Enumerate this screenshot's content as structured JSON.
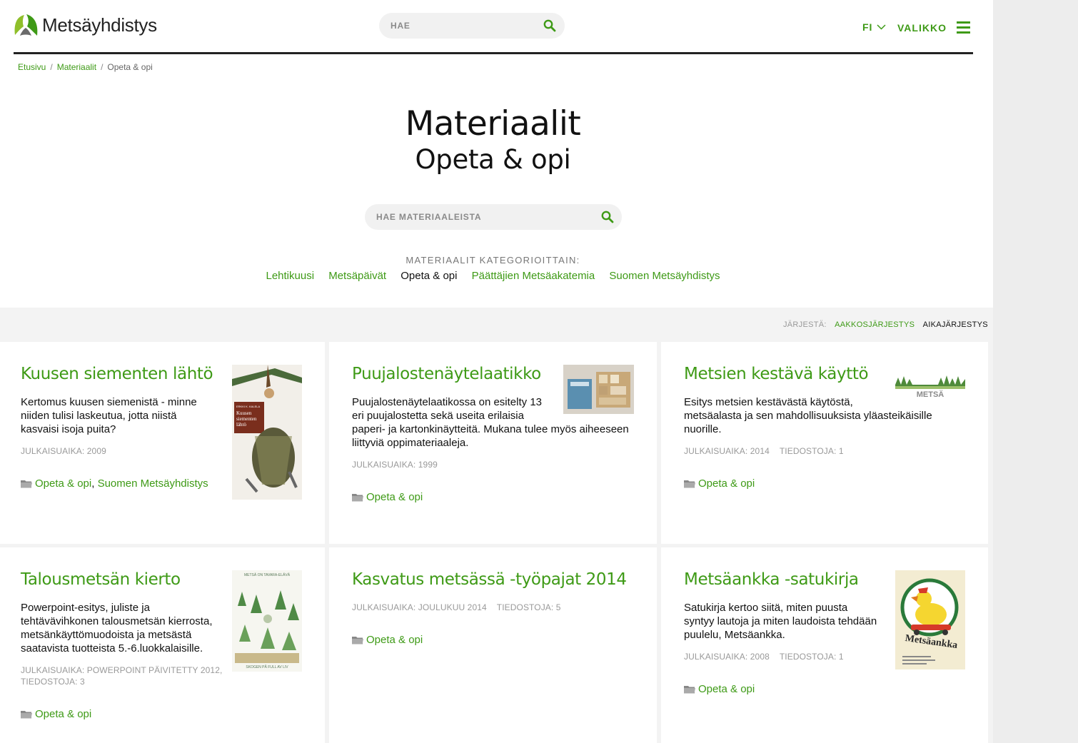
{
  "header": {
    "logo_text": "Metsäyhdistys",
    "search_placeholder": "HAE",
    "lang": "FI",
    "menu_label": "VALIKKO"
  },
  "breadcrumb": [
    "Etusivu",
    "Materiaalit",
    "Opeta & opi"
  ],
  "page": {
    "title": "Materiaalit",
    "subtitle": "Opeta & opi",
    "search_placeholder": "HAE MATERIAALEISTA",
    "categories_label": "MATERIAALIT KATEGORIOITTAIN:",
    "categories": [
      "Lehtikuusi",
      "Metsäpäivät",
      "Opeta & opi",
      "Päättäjien Metsäakatemia",
      "Suomen Metsäyhdistys"
    ],
    "active_category": "Opeta & opi"
  },
  "sort": {
    "label": "JÄRJESTÄ:",
    "options": [
      "AAKKOSJÄRJESTYS",
      "AIKAJÄRJESTYS"
    ],
    "active": "AIKAJÄRJESTYS"
  },
  "cards": [
    {
      "title": "Kuusen siementen lähtö",
      "desc_lines": [
        "Kertomus kuusen siemenistä - minne",
        "niiden tulisi laskeutua, jotta niistä",
        "kasvaisi isoja puita?"
      ],
      "meta": [
        "JULKAISUAIKA: 2009"
      ],
      "tags": [
        "Opeta & opi",
        "Suomen Metsäyhdistys"
      ],
      "thumb_text": [
        "ERKKI K. KALELA",
        "Kuusen",
        "siementen",
        "lähtö"
      ]
    },
    {
      "title": "Puujalostenäytelaatikko",
      "desc_lines": [
        "Puujalostenäytelaatikossa on esitelty 13",
        "eri puujalostetta sekä useita erilaisia",
        "paperi- ja kartonkinäytteitä. Mukana tulee myös aiheeseen",
        "liittyviä oppimateriaaleja."
      ],
      "meta": [
        "JULKAISUAIKA: 1999"
      ],
      "tags": [
        "Opeta & opi"
      ]
    },
    {
      "title": "Metsien kestävä käyttö",
      "desc_lines": [
        "Esitys metsien kestävästä käytöstä,",
        "metsäalasta ja sen mahdollisuuksista yläasteikäisille",
        "nuorille."
      ],
      "meta": [
        "JULKAISUAIKA: 2014",
        "TIEDOSTOJA: 1"
      ],
      "tags": [
        "Opeta & opi"
      ],
      "thumb_text": "METSÄ"
    },
    {
      "title": "Talousmetsän kierto",
      "desc_lines": [
        "Powerpoint-esitys, juliste ja",
        "tehtävävihkonen talousmetsän kierrosta,",
        "metsänkäyttömuodoista ja metsästä",
        "saatavista tuotteista 5.-6.luokkalaisille."
      ],
      "meta_lines": [
        "JULKAISUAIKA: POWERPOINT PÄIVITETTY 2012,",
        "TIEDOSTOJA: 3"
      ],
      "tags": [
        "Opeta & opi"
      ],
      "thumb_text": [
        "METSÄ ON TAVARA-ELÄVÄ",
        "SKOGEN PÅ FULL AV LIV"
      ]
    },
    {
      "title": "Kasvatus metsässä -työpajat 2014",
      "meta": [
        "JULKAISUAIKA: JOULUKUU 2014",
        "TIEDOSTOJA: 5"
      ],
      "tags": [
        "Opeta & opi"
      ]
    },
    {
      "title": "Metsäankka -satukirja",
      "desc_lines": [
        "Satukirja kertoo siitä, miten puusta",
        "syntyy lautoja ja miten laudoista tehdään",
        "puulelu, Metsäankka."
      ],
      "meta": [
        "JULKAISUAIKA: 2008",
        "TIEDOSTOJA: 1"
      ],
      "tags": [
        "Opeta & opi"
      ],
      "thumb_text": "Metsäankka"
    }
  ],
  "colors": {
    "accent": "#3e9a16",
    "text": "#111111",
    "muted": "#999999",
    "band": "#f3f3f3"
  }
}
